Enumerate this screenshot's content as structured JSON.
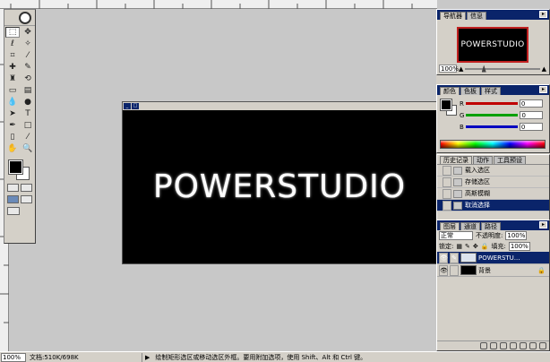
{
  "document": {
    "canvas_text": "POWERSTUDIO"
  },
  "toolbox": {
    "tools": [
      "marquee",
      "move",
      "lasso",
      "magic-wand",
      "crop",
      "slice",
      "heal",
      "brush",
      "stamp",
      "history-brush",
      "eraser",
      "gradient",
      "blur",
      "dodge",
      "path-select",
      "type",
      "pen",
      "shape",
      "notes",
      "eyedropper",
      "hand",
      "zoom"
    ]
  },
  "navigator": {
    "tabs": [
      "导航器",
      "信息"
    ],
    "thumbnail_text": "POWERSTUDIO",
    "zoom": "100%"
  },
  "color_panel": {
    "tabs": [
      "颜色",
      "色板",
      "样式"
    ],
    "channels": [
      {
        "label": "R",
        "value": "0",
        "color": "#c00000"
      },
      {
        "label": "G",
        "value": "0",
        "color": "#00a000"
      },
      {
        "label": "B",
        "value": "0",
        "color": "#0000c0"
      }
    ]
  },
  "history_panel": {
    "tabs": [
      "历史记录",
      "动作",
      "工具预设"
    ],
    "items": [
      {
        "label": "载入选区"
      },
      {
        "label": "存储选区"
      },
      {
        "label": "高斯模糊"
      },
      {
        "label": "取消选择"
      }
    ]
  },
  "layers_panel": {
    "tabs": [
      "图层",
      "通道",
      "路径"
    ],
    "blend_mode": "正常",
    "opacity_label": "不透明度:",
    "opacity": "100%",
    "lock_label": "锁定:",
    "fill_label": "填充:",
    "fill": "100%",
    "layers": [
      {
        "name": "POWERSTU...",
        "thumb": "#dde4ee"
      },
      {
        "name": "背景",
        "thumb": "#000000"
      }
    ]
  },
  "status_bar": {
    "zoom": "100%",
    "doc_info": "文档:510K/698K",
    "hint": "绘制矩形选区或移动选区外框。要用附加选项，使用 Shift、Alt 和 Ctrl 键。"
  }
}
